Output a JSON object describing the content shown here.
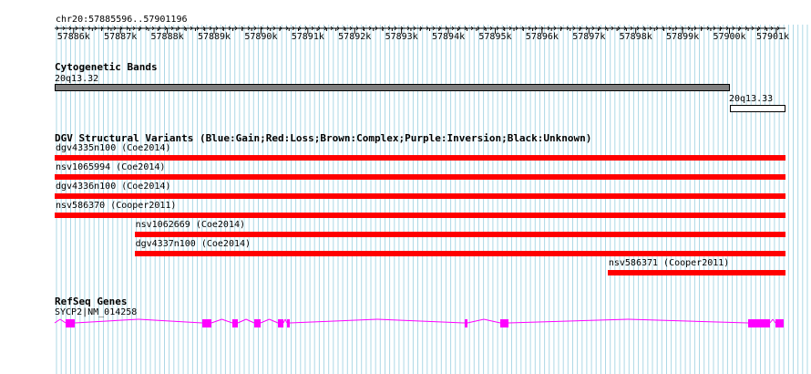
{
  "location": "chr20:57885596..57901196",
  "ruler": {
    "ticks": [
      "57886k",
      "57887k",
      "57888k",
      "57889k",
      "57890k",
      "57891k",
      "57892k",
      "57893k",
      "57894k",
      "57895k",
      "57896k",
      "57897k",
      "57898k",
      "57899k",
      "57900k",
      "57901k"
    ]
  },
  "cytoband": {
    "title": "Cytogenetic Bands",
    "bands": [
      {
        "label": "20q13.32",
        "color": "#808080",
        "start": 57885596,
        "end": 57900000
      },
      {
        "label": "20q13.33",
        "color": "#ffffff",
        "start": 57900000,
        "end": 57901196
      }
    ]
  },
  "dgv": {
    "title": "DGV Structural Variants (Blue:Gain;Red:Loss;Brown:Complex;Purple:Inversion;Black:Unknown)",
    "color": "#ff0000",
    "variants": [
      {
        "label": "dgv4335n100 (Coe2014)",
        "start": 57885596,
        "end": 57901196
      },
      {
        "label": "nsv1065994 (Coe2014)",
        "start": 57885596,
        "end": 57901196
      },
      {
        "label": "dgv4336n100 (Coe2014)",
        "start": 57885596,
        "end": 57901196
      },
      {
        "label": "nsv586370 (Cooper2011)",
        "start": 57885596,
        "end": 57901196
      },
      {
        "label": "nsv1062669 (Coe2014)",
        "start": 57887300,
        "end": 57901196
      },
      {
        "label": "dgv4337n100 (Coe2014)",
        "start": 57887300,
        "end": 57901196
      },
      {
        "label": "nsv586371 (Cooper2011)",
        "start": 57897400,
        "end": 57901196
      }
    ]
  },
  "refseq": {
    "title": "RefSeq Genes",
    "gene_label": "SYCP2|NM_014258",
    "color": "#ff00ff"
  },
  "colors": {
    "grid": "#add8e6",
    "ruler": "#000000"
  }
}
